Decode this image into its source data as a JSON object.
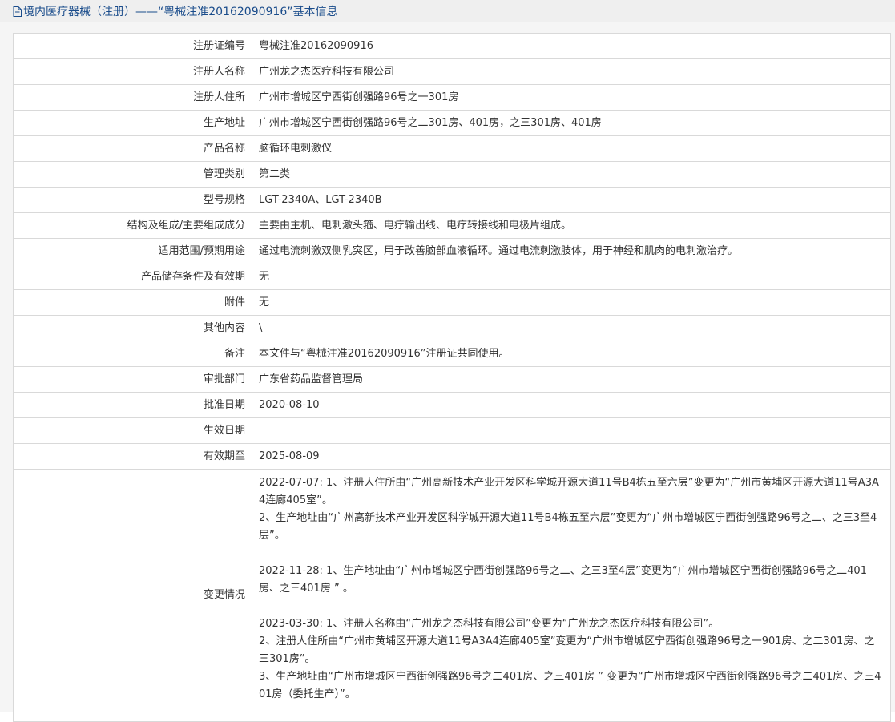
{
  "header": {
    "title": "境内医疗器械（注册）——“粤械注准20162090916”基本信息"
  },
  "rows": [
    {
      "label": "注册证编号",
      "value": "粤械注准20162090916"
    },
    {
      "label": "注册人名称",
      "value": "广州龙之杰医疗科技有限公司"
    },
    {
      "label": "注册人住所",
      "value": "广州市增城区宁西街创强路96号之一301房"
    },
    {
      "label": "生产地址",
      "value": "广州市增城区宁西街创强路96号之二301房、401房，之三301房、401房"
    },
    {
      "label": "产品名称",
      "value": "脑循环电刺激仪"
    },
    {
      "label": "管理类别",
      "value": "第二类"
    },
    {
      "label": "型号规格",
      "value": "LGT-2340A、LGT-2340B"
    },
    {
      "label": "结构及组成/主要组成成分",
      "value": "主要由主机、电刺激头箍、电疗输出线、电疗转接线和电极片组成。"
    },
    {
      "label": "适用范围/预期用途",
      "value": "通过电流刺激双侧乳突区，用于改善脑部血液循环。通过电流刺激肢体，用于神经和肌肉的电刺激治疗。"
    },
    {
      "label": "产品储存条件及有效期",
      "value": "无"
    },
    {
      "label": "附件",
      "value": "无"
    },
    {
      "label": "其他内容",
      "value": "\\"
    },
    {
      "label": "备注",
      "value": "本文件与“粤械注准20162090916”注册证共同使用。"
    },
    {
      "label": "审批部门",
      "value": "广东省药品监督管理局"
    },
    {
      "label": "批准日期",
      "value": "2020-08-10"
    },
    {
      "label": "生效日期",
      "value": ""
    },
    {
      "label": "有效期至",
      "value": "2025-08-09"
    }
  ],
  "changes": {
    "label": "变更情况",
    "blocks": [
      [
        "2022-07-07: 1、注册人住所由“广州高新技术产业开发区科学城开源大道11号B4栋五至六层”变更为“广州市黄埔区开源大道11号A3A4连廊405室”。",
        "2、生产地址由“广州高新技术产业开发区科学城开源大道11号B4栋五至六层”变更为“广州市增城区宁西街创强路96号之二、之三3至4层”。"
      ],
      [
        "2022-11-28: 1、生产地址由“广州市增城区宁西街创强路96号之二、之三3至4层”变更为“广州市增城区宁西街创强路96号之二401房、之三401房 ” 。"
      ],
      [
        "2023-03-30: 1、注册人名称由“广州龙之杰科技有限公司”变更为“广州龙之杰医疗科技有限公司”。",
        "2、注册人住所由“广州市黄埔区开源大道11号A3A4连廊405室”变更为“广州市增城区宁西街创强路96号之一901房、之二301房、之三301房”。",
        "3、生产地址由“广州市增城区宁西街创强路96号之二401房、之三401房 ” 变更为“广州市增城区宁西街创强路96号之二401房、之三401房（委托生产）”。"
      ]
    ]
  }
}
